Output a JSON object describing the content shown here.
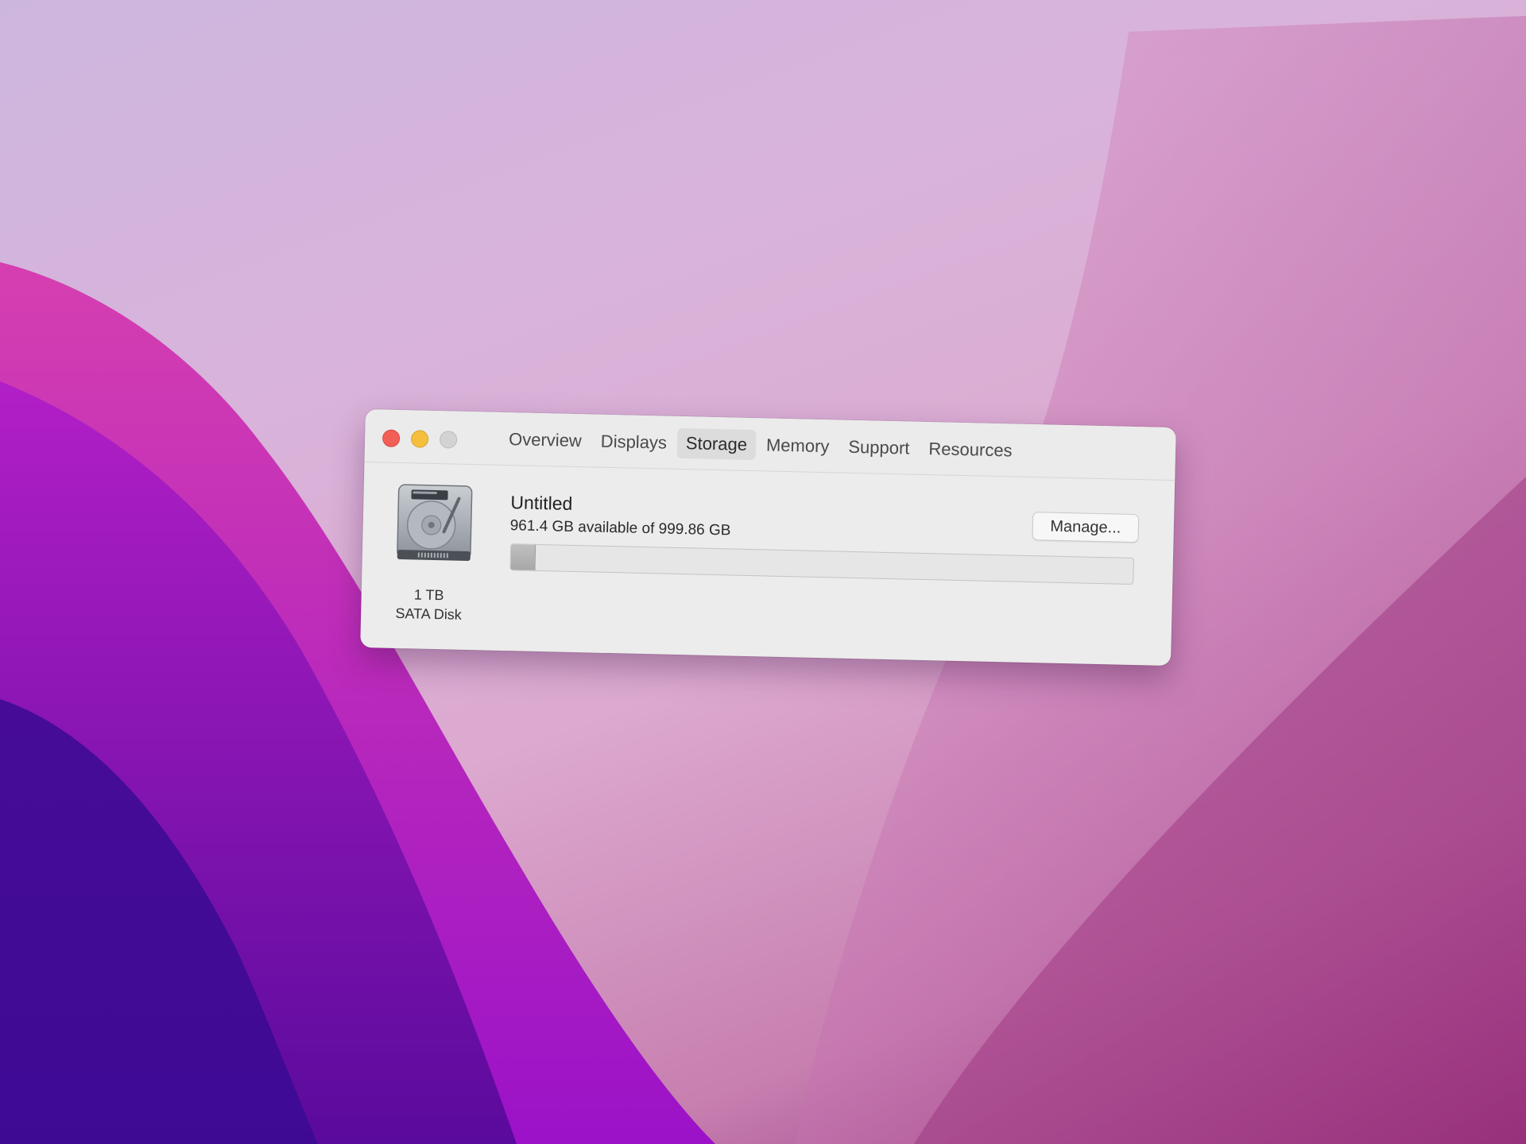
{
  "window": {
    "tabs": [
      {
        "label": "Overview"
      },
      {
        "label": "Displays"
      },
      {
        "label": "Storage"
      },
      {
        "label": "Memory"
      },
      {
        "label": "Support"
      },
      {
        "label": "Resources"
      }
    ],
    "active_tab": "Storage"
  },
  "disk": {
    "icon": "hard-drive-icon",
    "capacity_label": "1 TB",
    "type_label": "SATA Disk"
  },
  "volume": {
    "name": "Untitled",
    "availability": "961.4 GB available of 999.86 GB",
    "used_fraction": 0.0385
  },
  "buttons": {
    "manage_label": "Manage..."
  },
  "colors": {
    "close": "#f25f57",
    "minimize": "#f5be3d",
    "zoom": "#d3d3d3"
  }
}
